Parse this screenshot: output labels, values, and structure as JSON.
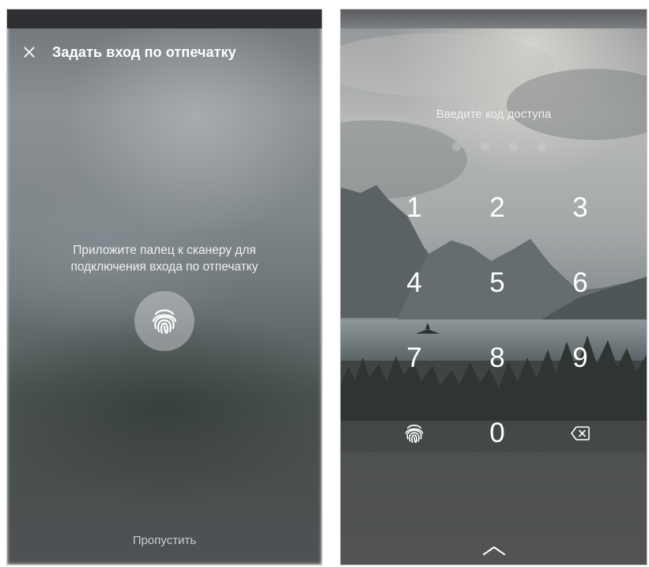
{
  "left_screen": {
    "header": {
      "title": "Задать вход по отпечатку",
      "close_icon": "close-icon"
    },
    "instruction_line1": "Приложите палец к сканеру для",
    "instruction_line2": "подключения входа по отпечатку",
    "fingerprint_icon": "fingerprint-icon",
    "skip_label": "Пропустить"
  },
  "right_screen": {
    "prompt": "Введите код доступа",
    "passcode_length": 4,
    "keypad": {
      "keys": [
        "1",
        "2",
        "3",
        "4",
        "5",
        "6",
        "7",
        "8",
        "9",
        "0"
      ],
      "fingerprint_icon": "fingerprint-icon",
      "backspace_icon": "backspace-icon"
    },
    "swipe_icon": "chevron-up-icon"
  },
  "colors": {
    "text_primary": "#ffffff",
    "text_secondary": "#c9cccf",
    "status_bar": "#2d2f33"
  }
}
